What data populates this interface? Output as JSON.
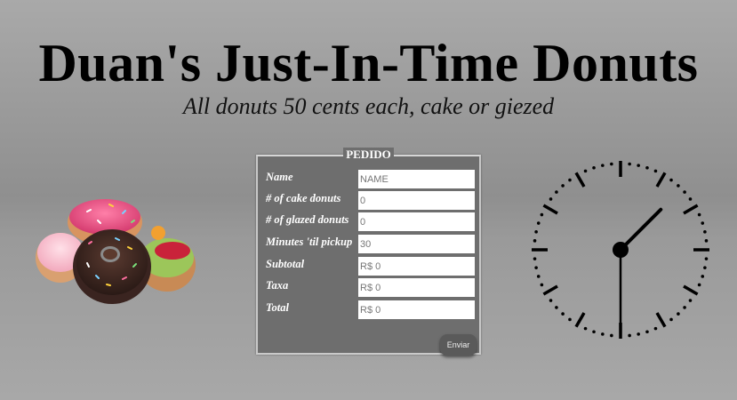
{
  "header": {
    "title": "Duan's Just-In-Time Donuts",
    "subtitle": "All donuts 50 cents each, cake or giezed"
  },
  "image": {
    "icon": "donuts-image"
  },
  "form": {
    "legend": "PEDIDO",
    "fields": [
      {
        "label": "Name",
        "value": "",
        "placeholder": "NAME"
      },
      {
        "label": "# of cake donuts",
        "value": "0"
      },
      {
        "label": "# of glazed donuts",
        "value": "0"
      },
      {
        "label": "Minutes 'til pickup",
        "value": "30"
      },
      {
        "label": "Subtotal",
        "value": "R$ 0"
      },
      {
        "label": "Taxa",
        "value": "R$ 0"
      },
      {
        "label": "Total",
        "value": "R$ 0"
      }
    ],
    "submit_label": "Enviar"
  },
  "clock": {
    "hour": 1,
    "minute": 30,
    "color": "#000000"
  }
}
